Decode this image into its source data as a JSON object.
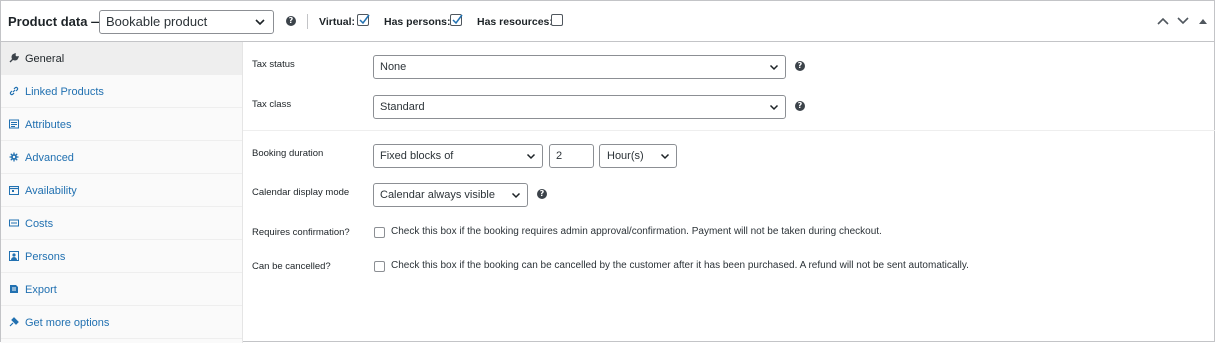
{
  "header": {
    "title": "Product data —",
    "product_type": "Bookable product",
    "options": {
      "virtual": "Virtual:",
      "has_persons": "Has persons:",
      "has_resources": "Has resources:"
    },
    "virtual_checked": true,
    "has_persons_checked": true,
    "has_resources_checked": false
  },
  "sidebar": {
    "items": [
      {
        "label": "General",
        "icon": "wrench-icon"
      },
      {
        "label": "Linked Products",
        "icon": "link-icon"
      },
      {
        "label": "Attributes",
        "icon": "list-icon"
      },
      {
        "label": "Advanced",
        "icon": "gear-icon"
      },
      {
        "label": "Availability",
        "icon": "calendar-icon"
      },
      {
        "label": "Costs",
        "icon": "money-icon"
      },
      {
        "label": "Persons",
        "icon": "person-icon"
      },
      {
        "label": "Export",
        "icon": "export-icon"
      },
      {
        "label": "Get more options",
        "icon": "plugin-icon"
      }
    ],
    "active": "General"
  },
  "general": {
    "tax_status": {
      "label": "Tax status",
      "value": "None"
    },
    "tax_class": {
      "label": "Tax class",
      "value": "Standard"
    },
    "booking_duration": {
      "label": "Booking duration",
      "type": "Fixed blocks of",
      "amount": "2",
      "unit": "Hour(s)"
    },
    "calendar_display": {
      "label": "Calendar display mode",
      "value": "Calendar always visible"
    },
    "requires_confirmation": {
      "label": "Requires confirmation?",
      "description": "Check this box if the booking requires admin approval/confirmation. Payment will not be taken during checkout."
    },
    "can_be_cancelled": {
      "label": "Can be cancelled?",
      "description": "Check this box if the booking can be cancelled by the customer after it has been purchased. A refund will not be sent automatically."
    }
  },
  "colors": {
    "link": "#2271b1",
    "border": "#c3c4c7",
    "active_tab": "#eeeeee"
  }
}
